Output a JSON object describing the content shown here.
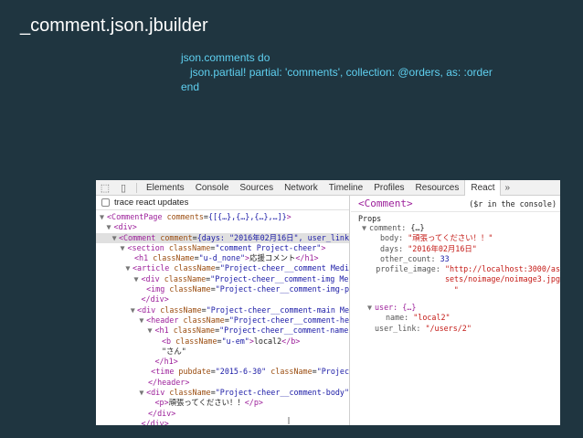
{
  "slide": {
    "title": "_comment.json.jbuilder",
    "code": [
      "json.comments do",
      "   json.partial! partial: 'comments', collection: @orders, as: :order",
      "end"
    ]
  },
  "devtools": {
    "tabs": [
      "Elements",
      "Console",
      "Sources",
      "Network",
      "Timeline",
      "Profiles",
      "Resources",
      "React"
    ],
    "active_tab": "React",
    "more": "»",
    "trace_label": "trace react updates",
    "component_name": "<Comment>",
    "console_hint": "($r in the console)",
    "props_label": "Props"
  },
  "tree": [
    {
      "indent": 0,
      "arrow": "▼",
      "parts": [
        [
          "br",
          "<"
        ],
        [
          "tag",
          "CommentPage"
        ],
        [
          "txt",
          " "
        ],
        [
          "attr",
          "comments"
        ],
        [
          "txt",
          "="
        ],
        [
          "val",
          "{[{…},{…},{…},…]}"
        ],
        [
          "br",
          ">"
        ]
      ]
    },
    {
      "indent": 1,
      "arrow": "▼",
      "parts": [
        [
          "br",
          "<"
        ],
        [
          "tag",
          "div"
        ],
        [
          "br",
          ">"
        ]
      ]
    },
    {
      "indent": 2,
      "arrow": "▼",
      "sel": true,
      "parts": [
        [
          "br",
          "<"
        ],
        [
          "tag",
          "Comment"
        ],
        [
          "txt",
          " "
        ],
        [
          "attr",
          "comment"
        ],
        [
          "txt",
          "="
        ],
        [
          "val",
          "{days: \"2016年02月16日\", user_link"
        ]
      ]
    },
    {
      "indent": 3,
      "arrow": "▼",
      "parts": [
        [
          "br",
          "<"
        ],
        [
          "tag",
          "section"
        ],
        [
          "txt",
          " "
        ],
        [
          "attr",
          "className"
        ],
        [
          "txt",
          "="
        ],
        [
          "val",
          "\"comment Project-cheer\""
        ],
        [
          "br",
          ">"
        ]
      ]
    },
    {
      "indent": 4,
      "arrow": "",
      "parts": [
        [
          "br",
          "<"
        ],
        [
          "tag",
          "h1"
        ],
        [
          "txt",
          " "
        ],
        [
          "attr",
          "className"
        ],
        [
          "txt",
          "="
        ],
        [
          "val",
          "\"u-d_none\""
        ],
        [
          "br",
          ">"
        ],
        [
          "txt",
          "応援コメント"
        ],
        [
          "br",
          "</"
        ],
        [
          "tag",
          "h1"
        ],
        [
          "br",
          ">"
        ]
      ]
    },
    {
      "indent": 4,
      "arrow": "▼",
      "parts": [
        [
          "br",
          "<"
        ],
        [
          "tag",
          "article"
        ],
        [
          "txt",
          " "
        ],
        [
          "attr",
          "className"
        ],
        [
          "txt",
          "="
        ],
        [
          "val",
          "\"Project-cheer__comment Medi"
        ]
      ]
    },
    {
      "indent": 5,
      "arrow": "▼",
      "parts": [
        [
          "br",
          "<"
        ],
        [
          "tag",
          "div"
        ],
        [
          "txt",
          " "
        ],
        [
          "attr",
          "className"
        ],
        [
          "txt",
          "="
        ],
        [
          "val",
          "\"Project-cheer__comment-img Me"
        ]
      ]
    },
    {
      "indent": 6,
      "arrow": "",
      "parts": [
        [
          "br",
          "<"
        ],
        [
          "tag",
          "img"
        ],
        [
          "txt",
          " "
        ],
        [
          "attr",
          "className"
        ],
        [
          "txt",
          "="
        ],
        [
          "val",
          "\"Project-cheer__comment-img-p"
        ]
      ]
    },
    {
      "indent": 5,
      "arrow": "",
      "parts": [
        [
          "br",
          "</"
        ],
        [
          "tag",
          "div"
        ],
        [
          "br",
          ">"
        ]
      ]
    },
    {
      "indent": 5,
      "arrow": "▼",
      "parts": [
        [
          "br",
          "<"
        ],
        [
          "tag",
          "div"
        ],
        [
          "txt",
          " "
        ],
        [
          "attr",
          "className"
        ],
        [
          "txt",
          "="
        ],
        [
          "val",
          "\"Project-cheer__comment-main Me"
        ]
      ]
    },
    {
      "indent": 6,
      "arrow": "▼",
      "parts": [
        [
          "br",
          "<"
        ],
        [
          "tag",
          "header"
        ],
        [
          "txt",
          " "
        ],
        [
          "attr",
          "className"
        ],
        [
          "txt",
          "="
        ],
        [
          "val",
          "\"Project-cheer__comment-he"
        ]
      ]
    },
    {
      "indent": 7,
      "arrow": "▼",
      "parts": [
        [
          "br",
          "<"
        ],
        [
          "tag",
          "h1"
        ],
        [
          "txt",
          " "
        ],
        [
          "attr",
          "className"
        ],
        [
          "txt",
          "="
        ],
        [
          "val",
          "\"Project-cheer__comment-name"
        ]
      ]
    },
    {
      "indent": 8,
      "arrow": "",
      "parts": [
        [
          "br",
          "<"
        ],
        [
          "tag",
          "b"
        ],
        [
          "txt",
          " "
        ],
        [
          "attr",
          "className"
        ],
        [
          "txt",
          "="
        ],
        [
          "val",
          "\"u-em\""
        ],
        [
          "br",
          ">"
        ],
        [
          "txt",
          "local2"
        ],
        [
          "br",
          "</"
        ],
        [
          "tag",
          "b"
        ],
        [
          "br",
          ">"
        ]
      ]
    },
    {
      "indent": 8,
      "arrow": "",
      "parts": [
        [
          "txt",
          "\"さん\""
        ]
      ]
    },
    {
      "indent": 7,
      "arrow": "",
      "parts": [
        [
          "br",
          "</"
        ],
        [
          "tag",
          "h1"
        ],
        [
          "br",
          ">"
        ]
      ]
    },
    {
      "indent": 7,
      "arrow": "",
      "parts": [
        [
          "br",
          "<"
        ],
        [
          "tag",
          "time"
        ],
        [
          "txt",
          " "
        ],
        [
          "attr",
          "pubdate"
        ],
        [
          "txt",
          "="
        ],
        [
          "val",
          "\"2015-6-30\""
        ],
        [
          "txt",
          " "
        ],
        [
          "attr",
          "className"
        ],
        [
          "txt",
          "="
        ],
        [
          "val",
          "\"Projec"
        ]
      ]
    },
    {
      "indent": 6,
      "arrow": "",
      "parts": [
        [
          "br",
          "</"
        ],
        [
          "tag",
          "header"
        ],
        [
          "br",
          ">"
        ]
      ]
    },
    {
      "indent": 6,
      "arrow": "▼",
      "parts": [
        [
          "br",
          "<"
        ],
        [
          "tag",
          "div"
        ],
        [
          "txt",
          " "
        ],
        [
          "attr",
          "className"
        ],
        [
          "txt",
          "="
        ],
        [
          "val",
          "\"Project-cheer__comment-body\""
        ]
      ]
    },
    {
      "indent": 7,
      "arrow": "",
      "parts": [
        [
          "br",
          "<"
        ],
        [
          "tag",
          "p"
        ],
        [
          "br",
          ">"
        ],
        [
          "txt",
          "頑張ってください！！"
        ],
        [
          "br",
          "</"
        ],
        [
          "tag",
          "p"
        ],
        [
          "br",
          ">"
        ]
      ]
    },
    {
      "indent": 6,
      "arrow": "",
      "parts": [
        [
          "br",
          "</"
        ],
        [
          "tag",
          "div"
        ],
        [
          "br",
          ">"
        ]
      ]
    },
    {
      "indent": 5,
      "arrow": "",
      "parts": [
        [
          "br",
          "</"
        ],
        [
          "tag",
          "div"
        ],
        [
          "br",
          ">"
        ]
      ]
    },
    {
      "indent": 4,
      "arrow": "",
      "parts": [
        [
          "br",
          "</"
        ],
        [
          "tag",
          "article"
        ],
        [
          "br",
          ">"
        ]
      ]
    }
  ],
  "props": [
    {
      "indent": 0,
      "arrow": "▼",
      "parts": [
        [
          "pk",
          "comment: "
        ],
        [
          "txt",
          "{…}"
        ]
      ]
    },
    {
      "indent": 2,
      "arrow": "",
      "parts": [
        [
          "pk",
          "body: "
        ],
        [
          "ps",
          "\"頑張ってください！！\""
        ]
      ]
    },
    {
      "indent": 2,
      "arrow": "",
      "parts": [
        [
          "pk",
          "days: "
        ],
        [
          "ps",
          "\"2016年02月16日\""
        ]
      ]
    },
    {
      "indent": 2,
      "arrow": "",
      "parts": [
        [
          "pk",
          "other_count: "
        ],
        [
          "pn",
          "33"
        ]
      ]
    },
    {
      "indent": 2,
      "arrow": "",
      "parts": [
        [
          "pk",
          "profile_image: "
        ],
        [
          "ps",
          "\"http://localhost:3000/as"
        ]
      ]
    },
    {
      "indent": 2,
      "arrow": "",
      "parts": [
        [
          "txt",
          "                "
        ],
        [
          "ps",
          "sets/noimage/noimage3.jpg"
        ]
      ]
    },
    {
      "indent": 2,
      "arrow": "",
      "parts": [
        [
          "txt",
          "                "
        ],
        [
          "ps",
          "\""
        ]
      ]
    },
    {
      "gap": true
    },
    {
      "indent": 1,
      "arrow": "▼",
      "parts": [
        [
          "pp",
          "user: "
        ],
        [
          "pp",
          "{…}"
        ]
      ]
    },
    {
      "indent": 3,
      "arrow": "",
      "parts": [
        [
          "pk",
          "name: "
        ],
        [
          "ps",
          "\"local2\""
        ]
      ]
    },
    {
      "indent": 1,
      "arrow": "",
      "parts": [
        [
          "pk",
          "user_link: "
        ],
        [
          "ps",
          "\"/users/2\""
        ]
      ]
    }
  ]
}
